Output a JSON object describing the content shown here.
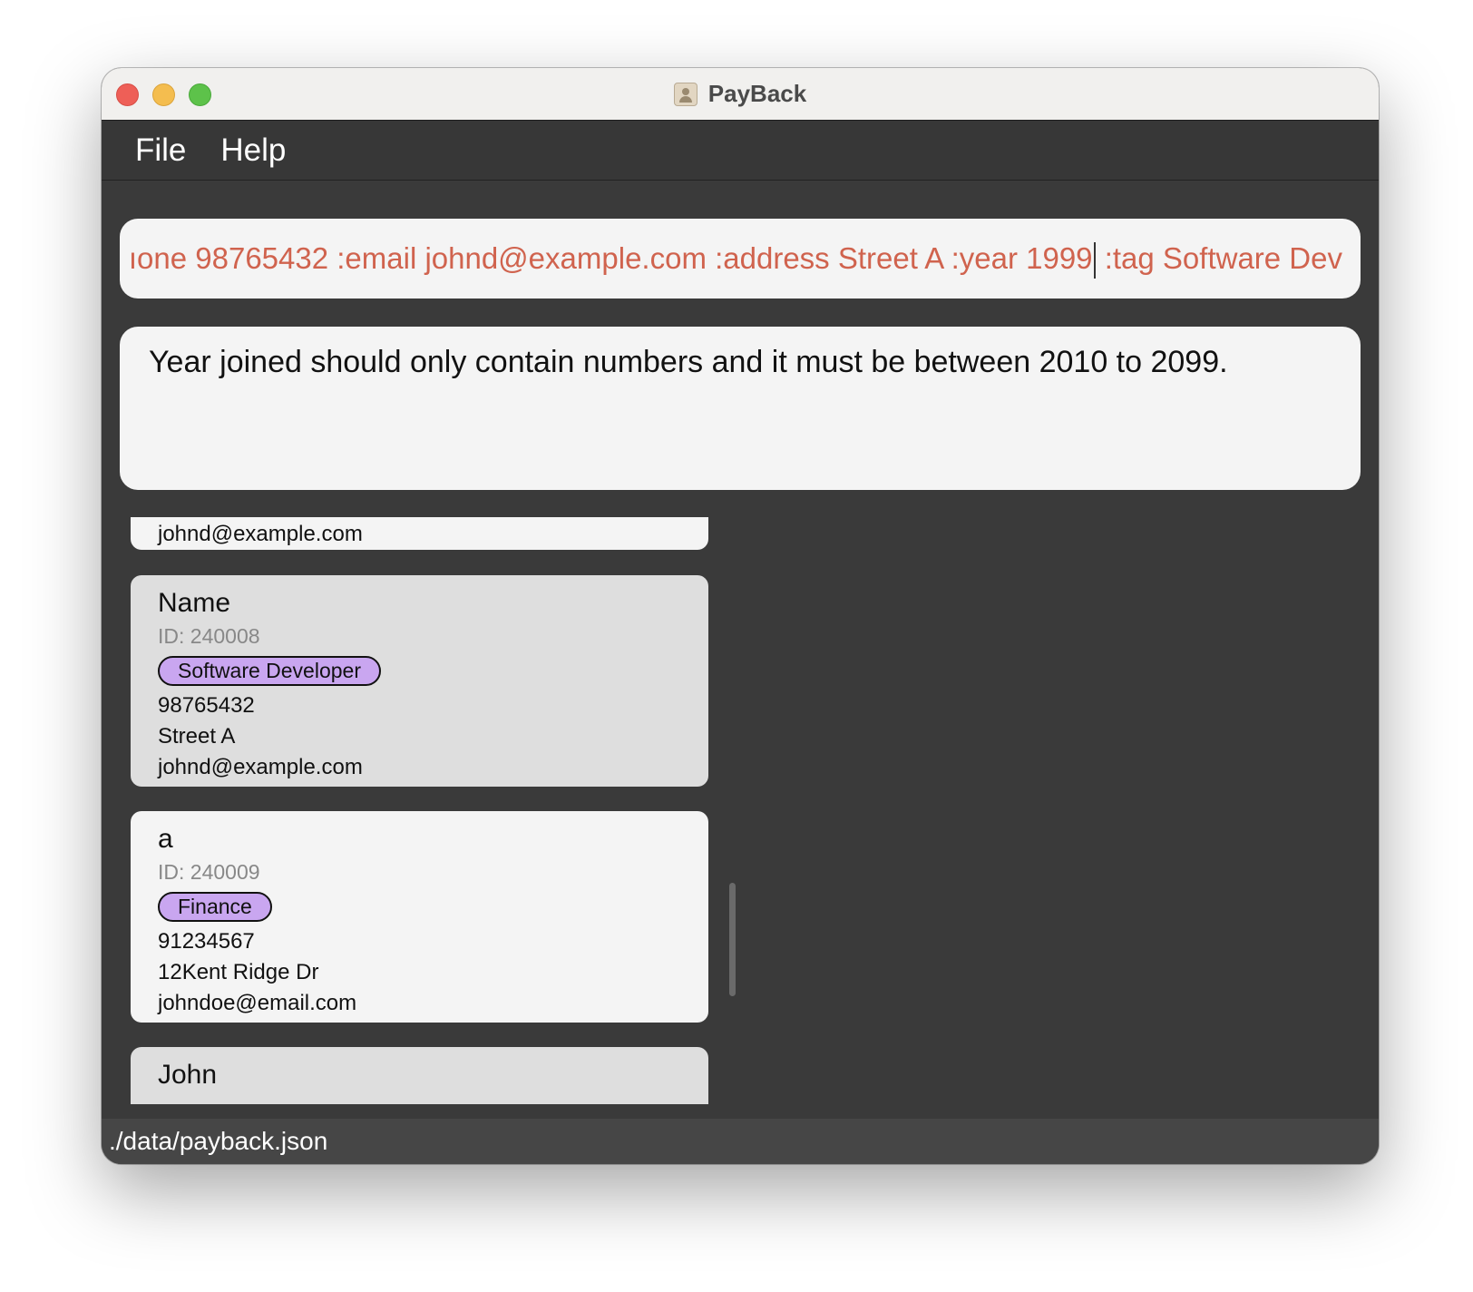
{
  "window": {
    "title": "PayBack",
    "icon": "address-book-icon"
  },
  "menu": {
    "file": "File",
    "help": "Help"
  },
  "command": {
    "text_before_caret": "ıone 98765432 :email johnd@example.com :address Street A :year 1999",
    "text_after_caret": " :tag Software Dev",
    "color": "#d0634e"
  },
  "result": {
    "message": "Year joined should only contain numbers and it must be between 2010 to 2099."
  },
  "persons": [
    {
      "partial_email": "johnd@example.com"
    },
    {
      "name": "Name",
      "id": "ID: 240008",
      "tag": "Software Developer",
      "phone": "98765432",
      "address": "Street A",
      "email": "johnd@example.com"
    },
    {
      "name": "a",
      "id": "ID: 240009",
      "tag": "Finance",
      "phone": "91234567",
      "address": "12Kent Ridge Dr",
      "email": "johndoe@email.com"
    },
    {
      "name": "John"
    }
  ],
  "status": {
    "path": "./data/payback.json"
  },
  "colors": {
    "tag_bg": "#c9a6f0",
    "panel_bg": "#3a3a3a"
  }
}
